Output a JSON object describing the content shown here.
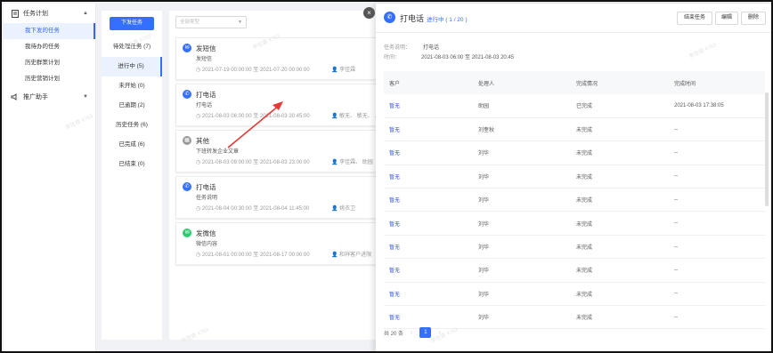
{
  "nav": {
    "group1_label": "任务计划",
    "items": [
      "我下发的任务",
      "我待办的任务",
      "历史群策计划",
      "历史营销计划"
    ],
    "group2_label": "推广助手"
  },
  "col2": {
    "primary_button": "下发任务",
    "categories": [
      {
        "label": "待处理任务 (7)"
      },
      {
        "label": "进行中 (5)"
      },
      {
        "label": "未开始 (0)"
      },
      {
        "label": "已逾期 (2)"
      },
      {
        "label": "历史任务 (6)"
      },
      {
        "label": "已完成 (6)"
      },
      {
        "label": "已结束 (0)"
      }
    ]
  },
  "filter": {
    "placeholder": "全部类型"
  },
  "cards": [
    {
      "title": "发短信",
      "desc": "发短信",
      "time": "2021-07-19 00:00:00 至 2021-07-20 00:00:00",
      "people": "李佳霖",
      "color": "#3370ff",
      "icon": "sms-icon"
    },
    {
      "title": "打电话",
      "desc": "打电话",
      "time": "2021-08-03 06:00:00 至 2021-08-03 20:45:00",
      "people": "敏无、 敏无、 ...",
      "color": "#3370ff",
      "icon": "phone-icon"
    },
    {
      "title": "其他",
      "desc": "下班转发企业文章",
      "time": "2021-08-03 09:00:00 至 2021-08-03 23:00:00",
      "people": "李佳霖、 助园",
      "color": "#999999",
      "icon": "other-icon"
    },
    {
      "title": "打电话",
      "desc": "任务说明",
      "time": "2021-08-04 00:30:00 至 2021-08-04 11:45:00",
      "people": "姚衣卫",
      "color": "#3370ff",
      "icon": "phone-icon"
    },
    {
      "title": "发微信",
      "desc": "微信内容",
      "time": "2021-08-01 00:00:00 至 2021-08-17 00:00:00",
      "people": "和祥客户进限",
      "color": "#2ecc71",
      "icon": "wechat-icon"
    }
  ],
  "detail": {
    "title": "打电话",
    "status": "进行中 ( 1 / 20 )",
    "buttons": [
      "结束任务",
      "编辑",
      "删除"
    ],
    "info_desc_label": "任务说明：",
    "info_desc_value": "打电话",
    "info_time_label": "时间：",
    "info_time_value": "2021-08-03 06:00 至 2021-08-03 20:45",
    "columns": [
      "客户",
      "处理人",
      "完成情况",
      "完成时间"
    ],
    "rows": [
      [
        "暂无",
        "助园",
        "已完成",
        "2021-08-03 17:38:05"
      ],
      [
        "暂无",
        "刘奎秋",
        "未完成",
        "--"
      ],
      [
        "暂无",
        "刘华",
        "未完成",
        "--"
      ],
      [
        "暂无",
        "刘华",
        "未完成",
        "--"
      ],
      [
        "暂无",
        "刘华",
        "未完成",
        "--"
      ],
      [
        "暂无",
        "刘华",
        "未完成",
        "--"
      ],
      [
        "暂无",
        "刘华",
        "未完成",
        "--"
      ],
      [
        "暂无",
        "刘华",
        "未完成",
        "--"
      ],
      [
        "暂无",
        "刘华",
        "未完成",
        "--"
      ],
      [
        "暂无",
        "刘华",
        "未完成",
        "--"
      ]
    ],
    "total": "共 20 条",
    "page": "1"
  },
  "watermark": "李佳霖 4763"
}
